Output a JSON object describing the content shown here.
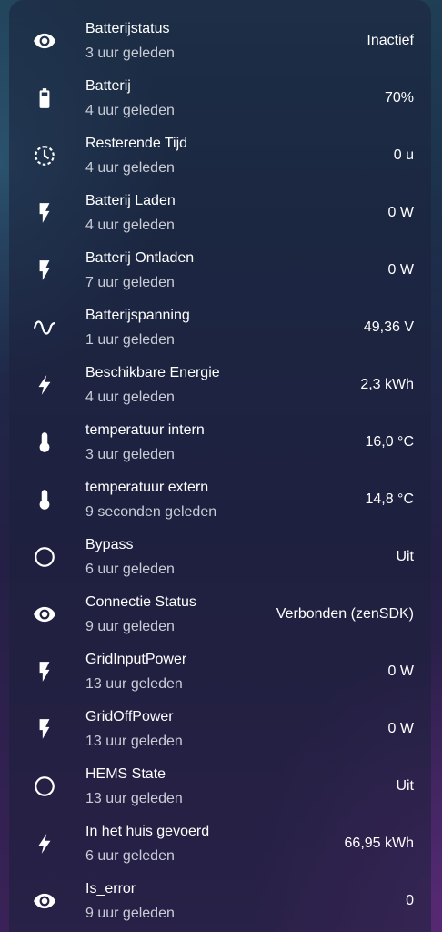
{
  "entities": [
    {
      "name": "Batterijstatus",
      "updated": "3 uur geleden",
      "value": "Inactief",
      "icon": "eye-icon"
    },
    {
      "name": "Batterij",
      "updated": "4 uur geleden",
      "value": "70%",
      "icon": "battery-icon"
    },
    {
      "name": "Resterende Tijd",
      "updated": "4 uur geleden",
      "value": "0 u",
      "icon": "timer-icon"
    },
    {
      "name": "Batterij Laden",
      "updated": "4 uur geleden",
      "value": "0 W",
      "icon": "flash-icon"
    },
    {
      "name": "Batterij Ontladen",
      "updated": "7 uur geleden",
      "value": "0 W",
      "icon": "flash-icon"
    },
    {
      "name": "Batterijspanning",
      "updated": "1 uur geleden",
      "value": "49,36 V",
      "icon": "sine-wave-icon"
    },
    {
      "name": "Beschikbare Energie",
      "updated": "4 uur geleden",
      "value": "2,3 kWh",
      "icon": "lightning-bolt-icon"
    },
    {
      "name": "temperatuur intern",
      "updated": "3 uur geleden",
      "value": "16,0 °C",
      "icon": "thermometer-icon"
    },
    {
      "name": "temperatuur extern",
      "updated": "9 seconden geleden",
      "value": "14,8 °C",
      "icon": "thermometer-icon"
    },
    {
      "name": "Bypass",
      "updated": "6 uur geleden",
      "value": "Uit",
      "icon": "circle-outline-icon"
    },
    {
      "name": "Connectie Status",
      "updated": "9 uur geleden",
      "value": "Verbonden (zenSDK)",
      "icon": "eye-icon"
    },
    {
      "name": "GridInputPower",
      "updated": "13 uur geleden",
      "value": "0 W",
      "icon": "flash-icon"
    },
    {
      "name": "GridOffPower",
      "updated": "13 uur geleden",
      "value": "0 W",
      "icon": "flash-icon"
    },
    {
      "name": "HEMS State",
      "updated": "13 uur geleden",
      "value": "Uit",
      "icon": "circle-outline-icon"
    },
    {
      "name": "In het huis gevoerd",
      "updated": "6 uur geleden",
      "value": "66,95 kWh",
      "icon": "lightning-bolt-icon"
    },
    {
      "name": "Is_error",
      "updated": "9 uur geleden",
      "value": "0",
      "icon": "eye-icon"
    }
  ]
}
